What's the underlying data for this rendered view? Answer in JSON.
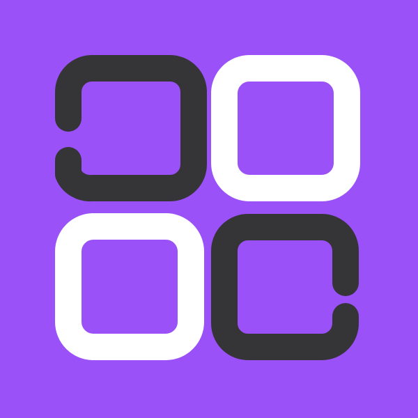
{
  "icon": {
    "semantic": "widget-grid-app-icon",
    "colors": {
      "background": "#9B51F8",
      "dark_tile": "#353437",
      "light_tile": "#FFFFFF"
    },
    "tiles": [
      {
        "name": "top-left-open-tile",
        "style": "open-left-gap",
        "tone": "dark_tile"
      },
      {
        "name": "top-right-square-tile",
        "style": "closed",
        "tone": "light_tile"
      },
      {
        "name": "bottom-left-square-tile",
        "style": "closed",
        "tone": "light_tile"
      },
      {
        "name": "bottom-right-open-tile",
        "style": "open-right-gap",
        "tone": "dark_tile"
      }
    ]
  }
}
